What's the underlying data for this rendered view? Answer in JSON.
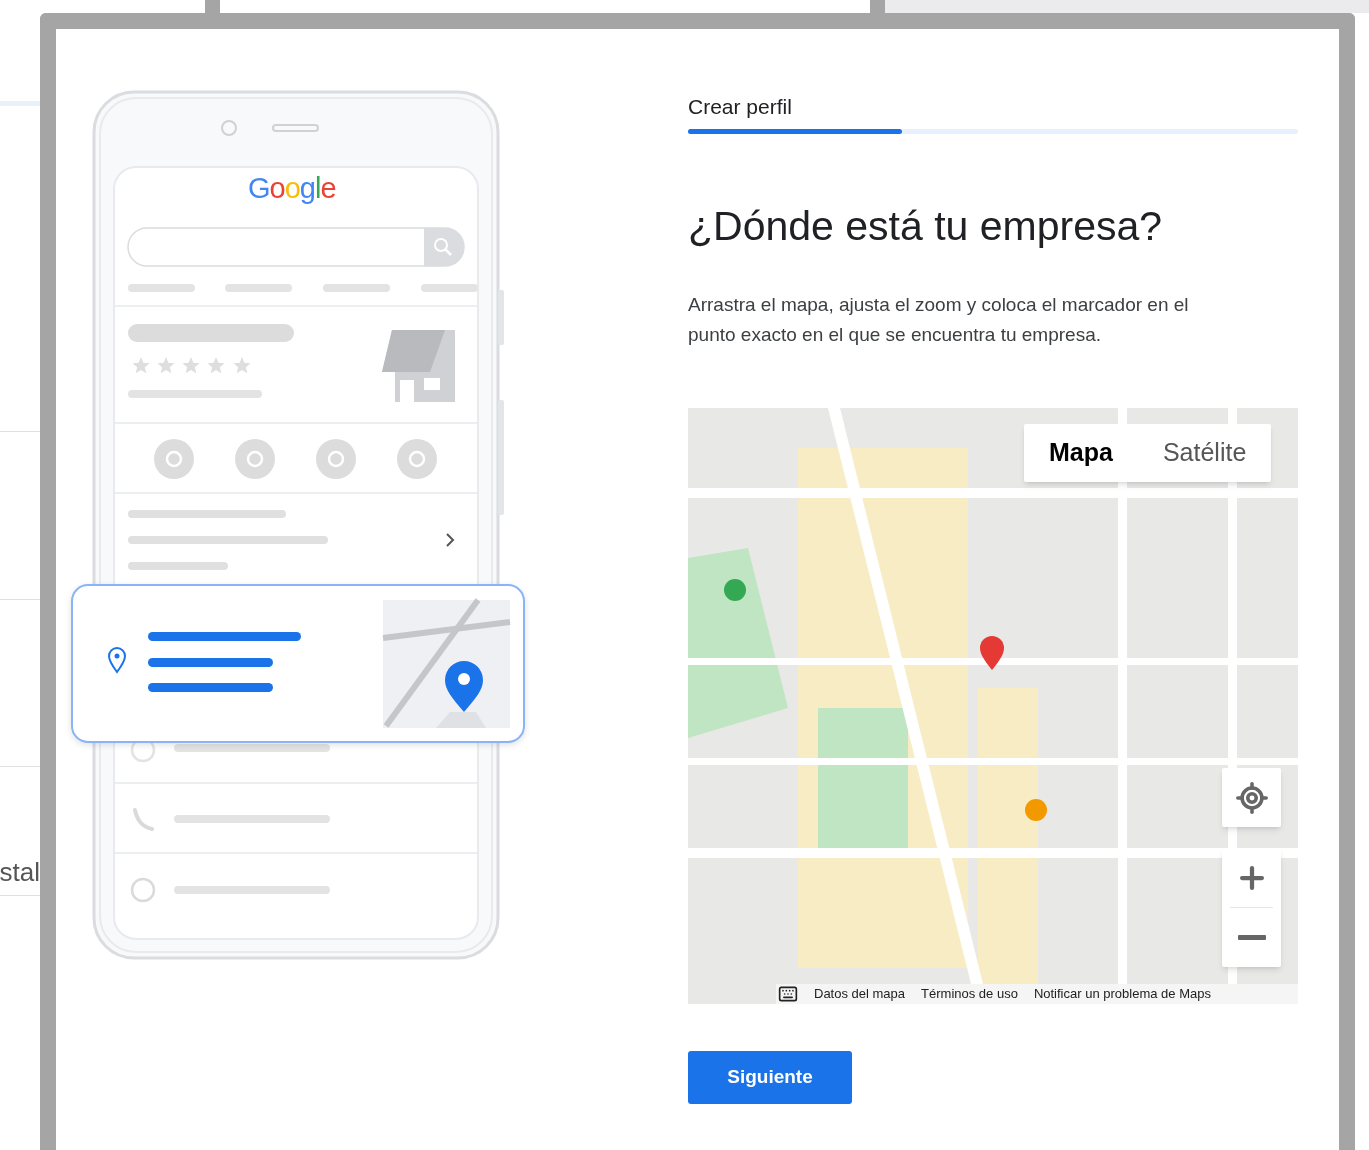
{
  "background_page": {
    "text": "stal"
  },
  "illustration": {
    "logo": "Google"
  },
  "progress": {
    "label": "Crear perfil",
    "level": 0.35
  },
  "heading": "¿Dónde está tu empresa?",
  "description": "Arrastra el mapa, ajusta el zoom y coloca el marcador en el punto exacto en el que se encuentra tu empresa.",
  "map": {
    "map_types": [
      {
        "label": "Mapa",
        "selected": true
      },
      {
        "label": "Satélite",
        "selected": false
      }
    ],
    "footer_links": [
      "Datos del mapa",
      "Términos de uso",
      "Notificar un problema de Maps"
    ]
  },
  "primary_button": "Siguiente"
}
